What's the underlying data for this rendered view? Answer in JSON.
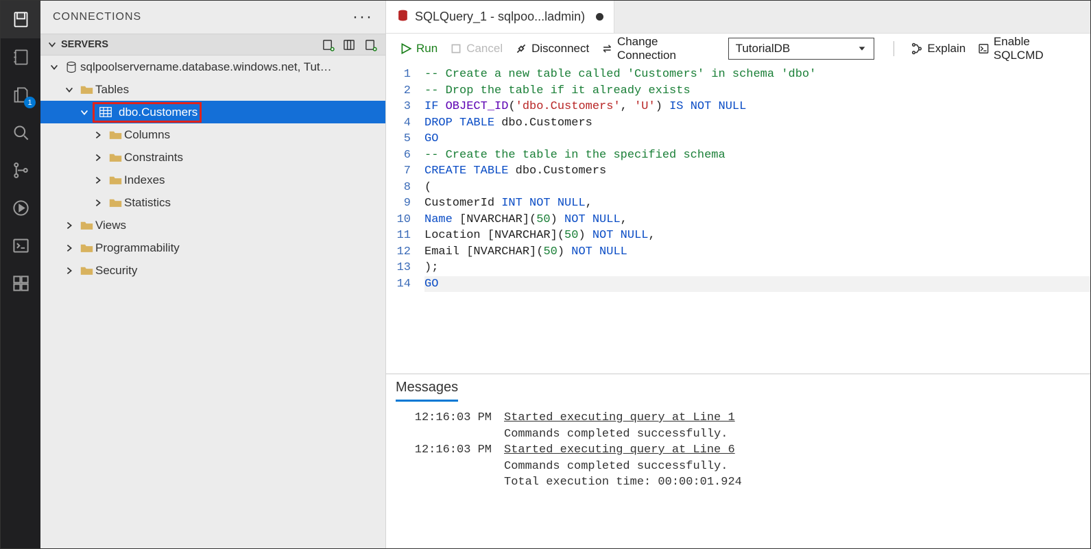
{
  "activity_badge": "1",
  "side": {
    "title": "CONNECTIONS",
    "section": "SERVERS",
    "server": "sqlpoolservername.database.windows.net, Tutorial...",
    "tables": "Tables",
    "customers": "dbo.Customers",
    "columns": "Columns",
    "constraints": "Constraints",
    "indexes": "Indexes",
    "statistics": "Statistics",
    "views": "Views",
    "programmability": "Programmability",
    "security": "Security"
  },
  "tab": {
    "title": "SQLQuery_1 - sqlpoo...ladmin)"
  },
  "actions": {
    "run": "Run",
    "cancel": "Cancel",
    "disconnect": "Disconnect",
    "change": "Change Connection",
    "explain": "Explain",
    "sqlcmd": "Enable SQLCMD",
    "database": "TutorialDB"
  },
  "code": [
    {
      "n": "1",
      "h": "<span class='tok-comment'>-- Create a new table called 'Customers' in schema 'dbo'</span>"
    },
    {
      "n": "2",
      "h": "<span class='tok-comment'>-- Drop the table if it already exists</span>"
    },
    {
      "n": "3",
      "h": "<span class='tok-kw'>IF</span> <span class='tok-fn'>OBJECT_ID</span>(<span class='tok-str'>'dbo.Customers'</span>, <span class='tok-str'>'U'</span>) <span class='tok-kw'>IS NOT NULL</span>"
    },
    {
      "n": "4",
      "h": "<span class='tok-kw'>DROP TABLE</span> dbo.Customers"
    },
    {
      "n": "5",
      "h": "<span class='tok-kw'>GO</span>"
    },
    {
      "n": "6",
      "h": "<span class='tok-comment'>-- Create the table in the specified schema</span>"
    },
    {
      "n": "7",
      "h": "<span class='tok-kw'>CREATE TABLE</span> dbo.Customers"
    },
    {
      "n": "8",
      "h": "("
    },
    {
      "n": "9",
      "h": "   CustomerId      <span class='tok-kw'>INT</span>    <span class='tok-kw'>NOT NULL</span>,"
    },
    {
      "n": "10",
      "h": "   <span class='tok-kw'>Name</span>     [NVARCHAR](<span class='tok-num'>50</span>)  <span class='tok-kw'>NOT NULL</span>,"
    },
    {
      "n": "11",
      "h": "   Location  [NVARCHAR](<span class='tok-num'>50</span>)  <span class='tok-kw'>NOT NULL</span>,"
    },
    {
      "n": "12",
      "h": "   Email     [NVARCHAR](<span class='tok-num'>50</span>)  <span class='tok-kw'>NOT NULL</span>"
    },
    {
      "n": "13",
      "h": ");"
    },
    {
      "n": "14",
      "h": "<span class='tok-kw'>GO</span>",
      "cur": true
    }
  ],
  "messages": {
    "title": "Messages",
    "rows": [
      {
        "time": "12:16:03 PM",
        "text": "Started executing query at Line 1",
        "u": true
      },
      {
        "time": "",
        "text": "Commands completed successfully."
      },
      {
        "time": "12:16:03 PM",
        "text": "Started executing query at Line 6",
        "u": true
      },
      {
        "time": "",
        "text": "Commands completed successfully."
      },
      {
        "time": "",
        "text": "Total execution time: 00:00:01.924"
      }
    ]
  }
}
